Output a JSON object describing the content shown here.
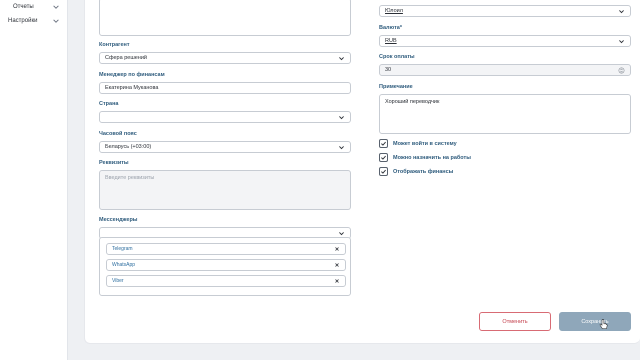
{
  "sidebar": {
    "items": [
      {
        "label": "Отчеты"
      },
      {
        "label": "Настройки"
      }
    ]
  },
  "form": {
    "top_left_value": "",
    "status": {
      "value": "Юлоил"
    },
    "contractor": {
      "label": "Контрагент",
      "value": "Сфера решений"
    },
    "finance_manager": {
      "label": "Менеджер по финансам",
      "value": "Екатерина Муканова"
    },
    "country": {
      "label": "Страна",
      "value": ""
    },
    "timezone": {
      "label": "Часовой пояс",
      "value": "Беларусь (+03:00)"
    },
    "requisites": {
      "label": "Реквизиты",
      "placeholder": "Введите реквизиты"
    },
    "messengers": {
      "label": "Мессенджеры",
      "select_value": "",
      "items": [
        {
          "label": "Telegram"
        },
        {
          "label": "WhatsApp"
        },
        {
          "label": "Viber"
        }
      ]
    },
    "currency": {
      "label": "Валюта*",
      "value": "RUB"
    },
    "payment_term": {
      "label": "Срок оплаты",
      "value": "30"
    },
    "note": {
      "label": "Примечание",
      "value": "Хороший переводчик"
    },
    "checkboxes": [
      {
        "label": "Может войти в систему",
        "checked": true
      },
      {
        "label": "Можно назначить на работы",
        "checked": true
      },
      {
        "label": "Отображать финансы",
        "checked": true
      }
    ]
  },
  "actions": {
    "cancel_label": "Отменить",
    "save_label": "Сохранить"
  },
  "colors": {
    "label": "#2f5c7d",
    "cancel": "#c4434f",
    "save_bg": "#8fa7ba",
    "chip_text": "#2f6fa0"
  }
}
